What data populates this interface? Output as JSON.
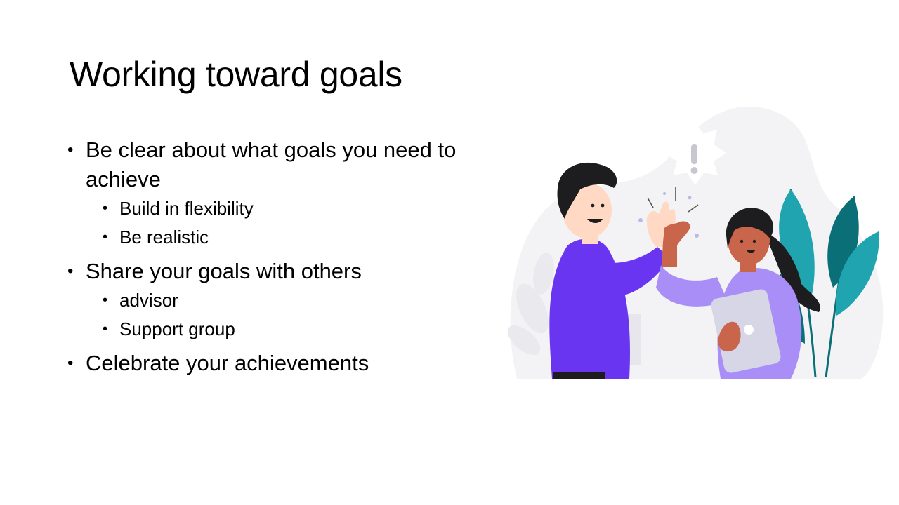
{
  "slide": {
    "title": "Working toward goals",
    "bullets": [
      {
        "text": "Be clear about what goals you need to achieve",
        "sub": [
          "Build in flexibility",
          "Be realistic"
        ]
      },
      {
        "text": "Share your goals with others",
        "sub": [
          "advisor",
          "Support group"
        ]
      },
      {
        "text": "Celebrate your achievements",
        "sub": []
      }
    ],
    "illustration": {
      "icon": "high-five-illustration",
      "colors": {
        "man_shirt": "#6a35f0",
        "woman_shirt": "#a98ef7",
        "skin_light": "#ffd9c4",
        "skin_dark": "#c9654a",
        "hair": "#1d1d1f",
        "leaf_teal": "#20a5b0",
        "leaf_dark": "#0b6f78",
        "blob": "#f3f3f5"
      }
    }
  }
}
